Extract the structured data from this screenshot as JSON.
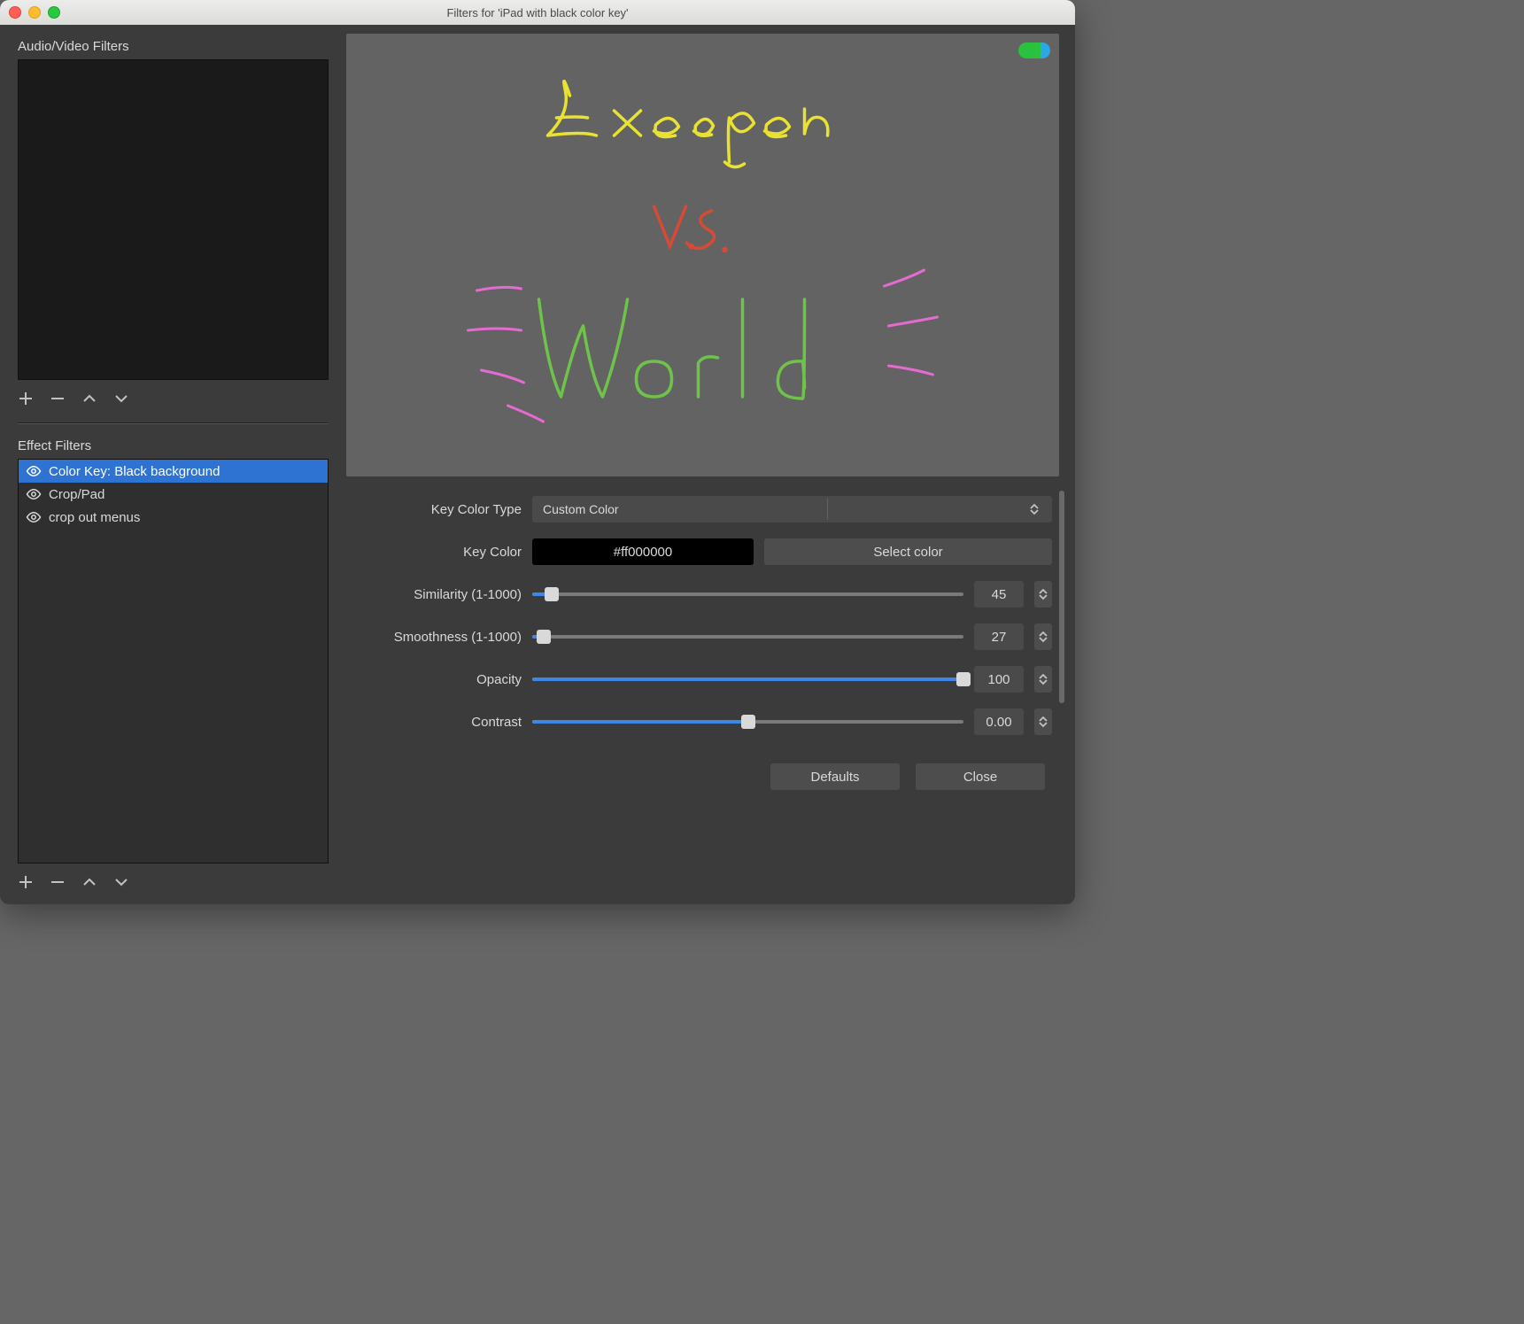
{
  "title": "Filters for 'iPad with black color key'",
  "sections": {
    "av_title": "Audio/Video Filters",
    "effect_title": "Effect Filters"
  },
  "effect_filters": [
    {
      "label": "Color Key: Black background",
      "selected": true,
      "visible": true
    },
    {
      "label": "Crop/Pad",
      "selected": false,
      "visible": true
    },
    {
      "label": "crop out menus",
      "selected": false,
      "visible": true
    }
  ],
  "preview": {
    "lines": [
      "Execgen",
      "V.S.",
      "World"
    ]
  },
  "params": {
    "key_color_type": {
      "label": "Key Color Type",
      "value": "Custom Color"
    },
    "key_color": {
      "label": "Key Color",
      "value": "#ff000000",
      "button": "Select color"
    },
    "similarity": {
      "label": "Similarity (1-1000)",
      "value": 45,
      "min": 1,
      "max": 1000
    },
    "smoothness": {
      "label": "Smoothness (1-1000)",
      "value": 27,
      "min": 1,
      "max": 1000
    },
    "opacity": {
      "label": "Opacity",
      "value": 100,
      "min": 0,
      "max": 100
    },
    "contrast": {
      "label": "Contrast",
      "value": "0.00",
      "percent": 50
    }
  },
  "buttons": {
    "defaults": "Defaults",
    "close": "Close"
  }
}
